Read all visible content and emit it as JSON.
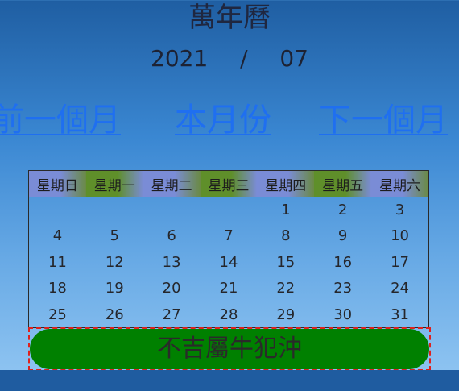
{
  "header": {
    "title": "萬年曆",
    "year": "2021",
    "separator": "/",
    "month": "07"
  },
  "nav": {
    "prev_label": "前一個月",
    "current_label": "本月份",
    "next_label": "下一個月"
  },
  "calendar": {
    "weekdays": [
      "星期日",
      "星期一",
      "星期二",
      "星期三",
      "星期四",
      "星期五",
      "星期六"
    ],
    "weeks": [
      [
        "",
        "",
        "",
        "",
        "1",
        "2",
        "3"
      ],
      [
        "4",
        "5",
        "6",
        "7",
        "8",
        "9",
        "10"
      ],
      [
        "11",
        "12",
        "13",
        "14",
        "15",
        "16",
        "17"
      ],
      [
        "18",
        "19",
        "20",
        "21",
        "22",
        "23",
        "24"
      ],
      [
        "25",
        "26",
        "27",
        "28",
        "29",
        "30",
        "31"
      ]
    ]
  },
  "fortune": {
    "text": "不吉屬牛犯沖"
  },
  "colors": {
    "link": "#1f6ff0",
    "header_blue": "#7a8cd6",
    "header_green": "#5f8f2a",
    "fortune_bar": "#008000",
    "dashed_border": "#e0201c"
  }
}
